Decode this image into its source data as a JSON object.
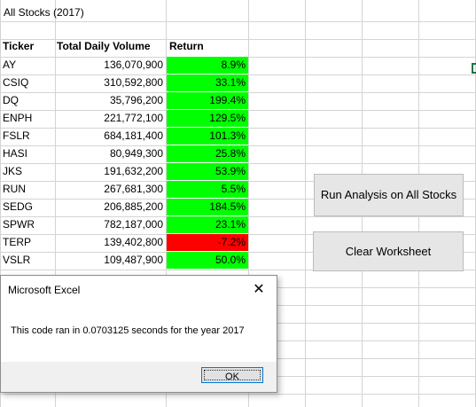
{
  "sheet": {
    "title": "All Stocks (2017)",
    "headers": {
      "ticker": "Ticker",
      "volume": "Total Daily Volume",
      "return": "Return"
    },
    "rows": [
      {
        "ticker": "AY",
        "volume": "136,070,900",
        "return": "8.9%",
        "status": "positive"
      },
      {
        "ticker": "CSIQ",
        "volume": "310,592,800",
        "return": "33.1%",
        "status": "positive"
      },
      {
        "ticker": "DQ",
        "volume": "35,796,200",
        "return": "199.4%",
        "status": "positive"
      },
      {
        "ticker": "ENPH",
        "volume": "221,772,100",
        "return": "129.5%",
        "status": "positive"
      },
      {
        "ticker": "FSLR",
        "volume": "684,181,400",
        "return": "101.3%",
        "status": "positive"
      },
      {
        "ticker": "HASI",
        "volume": "80,949,300",
        "return": "25.8%",
        "status": "positive"
      },
      {
        "ticker": "JKS",
        "volume": "191,632,200",
        "return": "53.9%",
        "status": "positive"
      },
      {
        "ticker": "RUN",
        "volume": "267,681,300",
        "return": "5.5%",
        "status": "positive"
      },
      {
        "ticker": "SEDG",
        "volume": "206,885,200",
        "return": "184.5%",
        "status": "positive"
      },
      {
        "ticker": "SPWR",
        "volume": "782,187,000",
        "return": "23.1%",
        "status": "positive"
      },
      {
        "ticker": "TERP",
        "volume": "139,402,800",
        "return": "-7.2%",
        "status": "negative"
      },
      {
        "ticker": "VSLR",
        "volume": "109,487,900",
        "return": "50.0%",
        "status": "positive"
      }
    ]
  },
  "buttons": {
    "run_label": "Run Analysis on All Stocks",
    "clear_label": "Clear Worksheet"
  },
  "dialog": {
    "title": "Microsoft Excel",
    "close_glyph": "✕",
    "message": "This code ran in 0.0703125 seconds for the year 2017",
    "ok_label": "OK"
  },
  "colors": {
    "positive": "#00ff00",
    "negative": "#ff0000",
    "gridline": "#d4d4d4"
  }
}
